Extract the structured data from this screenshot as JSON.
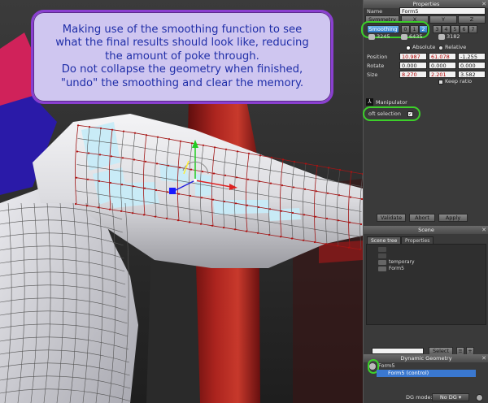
{
  "annotation": {
    "lines": [
      "Making use of the smoothing function to see",
      "what the final results should look like, reducing",
      "the amount of poke through.",
      "Do not collapse the geometry when finished,",
      "\"undo\" the smoothing and clear the memory."
    ]
  },
  "properties": {
    "title": "Properties",
    "name_label": "Name",
    "name_value": "Form5",
    "symmetry_label": "Symmetry",
    "axes": [
      "X",
      "Y",
      "Z"
    ],
    "smoothing_label": "Smoothing",
    "smoothing_levels": [
      "0",
      "1",
      "2",
      "3",
      "4",
      "5",
      "6",
      "7"
    ],
    "selected_level": "2",
    "counts": [
      "3245",
      "6435",
      "3182"
    ],
    "absolute_label": "Absolute",
    "relative_label": "Relative",
    "position_label": "Position",
    "position": [
      "10.987",
      "61.078",
      "-1.255"
    ],
    "rotate_label": "Rotate",
    "rotate": [
      "0.000",
      "0.000",
      "0.000"
    ],
    "size_label": "Size",
    "size": [
      "8.270",
      "2.201",
      "3.582"
    ],
    "keep_ratio_label": "Keep ratio",
    "manipulator_label": "Manipulator",
    "soft_selection_label": "oft selection",
    "validate_label": "Validate",
    "abort_label": "Abort",
    "apply_label": "Apply"
  },
  "scene": {
    "title": "Scene",
    "tabs": [
      "Scene tree",
      "Properties"
    ],
    "tree_items": [
      "temporary",
      "Form5"
    ],
    "select_label": "Select"
  },
  "dynamic_geometry": {
    "title": "Dynamic Geometry",
    "items": [
      "Form5",
      "Form5 (control)"
    ],
    "mode_label": "DG mode:",
    "mode_value": "No DG"
  },
  "colors": {
    "annotation_border": "#8a3fd0",
    "annotation_bg": "#cfc6f0",
    "annotation_text": "#1f2ea8",
    "highlight_ring": "#3ccf2a",
    "selected_faces": "#c8ecf8",
    "red_edges": "#a01818"
  }
}
